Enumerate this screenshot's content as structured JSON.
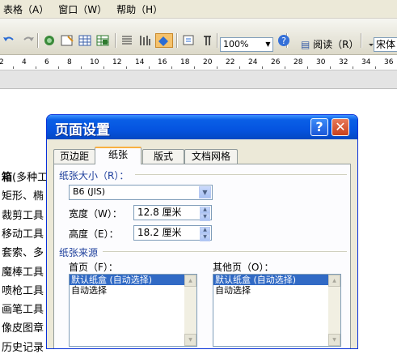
{
  "menubar": {
    "items": [
      "表格（A）",
      "窗口（W）",
      "帮助（H）"
    ]
  },
  "toolbar": {
    "zoom_value": "100%",
    "read_label": "阅读（R）",
    "font_value": "宋体"
  },
  "ruler": {
    "numbers": [
      "2",
      "4",
      "6",
      "8",
      "10",
      "12",
      "14",
      "16",
      "18",
      "20",
      "22",
      "24",
      "26",
      "28",
      "30",
      "32",
      "34",
      "36"
    ]
  },
  "document": {
    "lines": [
      {
        "bold": "箱",
        "rest": "(多种工"
      },
      {
        "bold": "",
        "rest": "矩形、椭"
      },
      {
        "bold": "",
        "rest": "裁剪工具"
      },
      {
        "bold": "",
        "rest": "移动工具"
      },
      {
        "bold": "",
        "rest": "套索、多"
      },
      {
        "bold": "",
        "rest": "魔棒工具"
      },
      {
        "bold": "",
        "rest": "喷枪工具"
      },
      {
        "bold": "",
        "rest": "画笔工具"
      },
      {
        "bold": "",
        "rest": "像皮图章"
      },
      {
        "bold": "",
        "rest": "历史记录"
      }
    ]
  },
  "dialog": {
    "title": "页面设置",
    "help_label": "?",
    "close_label": "✕",
    "tabs": [
      "页边距",
      "纸张",
      "版式",
      "文档网格"
    ],
    "active_tab": "纸张",
    "paper_size_label": "纸张大小（R）：",
    "paper_size_value": "B6 (JIS)",
    "width_label": "宽度（W）：",
    "width_value": "12.8 厘米",
    "height_label": "高度（E）：",
    "height_value": "18.2 厘米",
    "paper_source_label": "纸张来源",
    "first_page_label": "首页（F）：",
    "other_pages_label": "其他页（O）：",
    "first_page_items": [
      "默认纸盒 (自动选择)",
      "自动选择"
    ],
    "other_pages_items": [
      "默认纸盒 (自动选择)",
      "自动选择"
    ]
  },
  "colors": {
    "titlebar": "#0554e0",
    "selection": "#316ac5",
    "group_label": "#1e3f9c"
  }
}
